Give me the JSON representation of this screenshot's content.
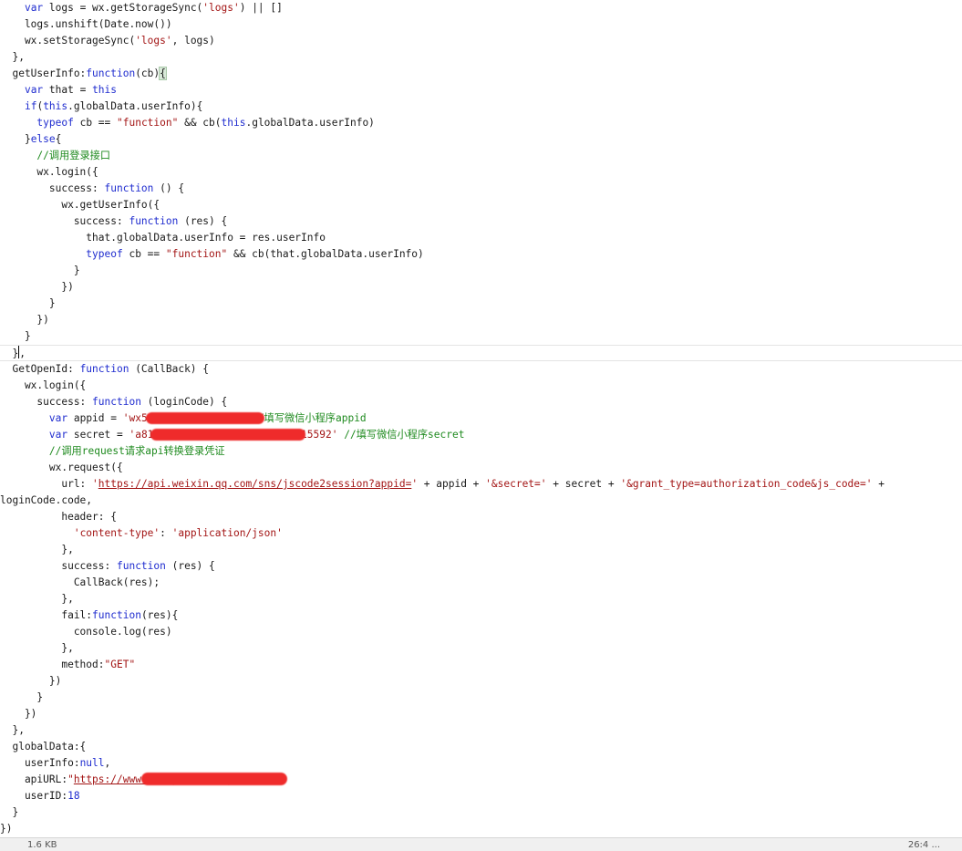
{
  "editor": {
    "lines": [
      [
        {
          "t": "    "
        },
        {
          "k": "kw",
          "t": "var"
        },
        {
          "t": " logs = wx.getStorageSync("
        },
        {
          "k": "str",
          "t": "'logs'"
        },
        {
          "t": ") || []"
        }
      ],
      [
        {
          "t": "    logs.unshift(Date.now())"
        }
      ],
      [
        {
          "t": "    wx.setStorageSync("
        },
        {
          "k": "str",
          "t": "'logs'"
        },
        {
          "t": ", logs)"
        }
      ],
      [
        {
          "t": "  },"
        }
      ],
      [
        {
          "t": "  getUserInfo:"
        },
        {
          "k": "kw",
          "t": "function"
        },
        {
          "t": "(cb)"
        },
        {
          "k": "bm",
          "t": "{"
        }
      ],
      [
        {
          "t": "    "
        },
        {
          "k": "kw",
          "t": "var"
        },
        {
          "t": " that = "
        },
        {
          "k": "kw",
          "t": "this"
        }
      ],
      [
        {
          "t": "    "
        },
        {
          "k": "kw",
          "t": "if"
        },
        {
          "t": "("
        },
        {
          "k": "kw",
          "t": "this"
        },
        {
          "t": ".globalData.userInfo){"
        }
      ],
      [
        {
          "t": "      "
        },
        {
          "k": "kw",
          "t": "typeof"
        },
        {
          "t": " cb == "
        },
        {
          "k": "str",
          "t": "\"function\""
        },
        {
          "t": " && cb("
        },
        {
          "k": "kw",
          "t": "this"
        },
        {
          "t": ".globalData.userInfo)"
        }
      ],
      [
        {
          "t": "    }"
        },
        {
          "k": "kw",
          "t": "else"
        },
        {
          "t": "{"
        }
      ],
      [
        {
          "t": "      "
        },
        {
          "k": "cm",
          "t": "//调用登录接口"
        }
      ],
      [
        {
          "t": "      wx.login({"
        }
      ],
      [
        {
          "t": "        success: "
        },
        {
          "k": "kw",
          "t": "function"
        },
        {
          "t": " () {"
        }
      ],
      [
        {
          "t": "          wx.getUserInfo({"
        }
      ],
      [
        {
          "t": "            success: "
        },
        {
          "k": "kw",
          "t": "function"
        },
        {
          "t": " (res) {"
        }
      ],
      [
        {
          "t": "              that.globalData.userInfo = res.userInfo"
        }
      ],
      [
        {
          "t": "              "
        },
        {
          "k": "kw",
          "t": "typeof"
        },
        {
          "t": " cb == "
        },
        {
          "k": "str",
          "t": "\"function\""
        },
        {
          "t": " && cb(that.globalData.userInfo)"
        }
      ],
      [
        {
          "t": "            }"
        }
      ],
      [
        {
          "t": "          })"
        }
      ],
      [
        {
          "t": "        }"
        }
      ],
      [
        {
          "t": "      })"
        }
      ],
      [
        {
          "t": "    }"
        }
      ],
      [
        {
          "t": "  }"
        },
        {
          "k": "cursor",
          "t": ""
        },
        {
          "t": ","
        }
      ],
      [
        {
          "t": "  GetOpenId: "
        },
        {
          "k": "kw",
          "t": "function"
        },
        {
          "t": " (CallBack) {"
        }
      ],
      [
        {
          "t": "    wx.login({"
        }
      ],
      [
        {
          "t": "      success: "
        },
        {
          "k": "kw",
          "t": "function"
        },
        {
          "t": " (loginCode) {"
        }
      ],
      [
        {
          "t": "        "
        },
        {
          "k": "kw",
          "t": "var"
        },
        {
          "t": " appid = "
        },
        {
          "k": "str",
          "t": "'wx5c4d8f2b1e3a7609'"
        },
        {
          "t": " "
        },
        {
          "k": "cm",
          "t": "//填写微信小程序appid"
        }
      ],
      [
        {
          "t": "        "
        },
        {
          "k": "kw",
          "t": "var"
        },
        {
          "t": " secret = "
        },
        {
          "k": "str",
          "t": "'a81d0f4c2b6e77d3a0c9bd5f19e15592'"
        },
        {
          "t": " "
        },
        {
          "k": "cm",
          "t": "//填写微信小程序secret"
        }
      ],
      [
        {
          "t": "        "
        },
        {
          "k": "cm",
          "t": "//调用request请求api转换登录凭证"
        }
      ],
      [
        {
          "t": "        wx.request({"
        }
      ],
      [
        {
          "t": "          url: "
        },
        {
          "k": "str",
          "t": "'"
        },
        {
          "k": "url",
          "t": "https://api.weixin.qq.com/sns/jscode2session?appid="
        },
        {
          "k": "str",
          "t": "'"
        },
        {
          "t": " + appid + "
        },
        {
          "k": "str",
          "t": "'&secret='"
        },
        {
          "t": " + secret + "
        },
        {
          "k": "str",
          "t": "'&grant_type=authorization_code&js_code='"
        },
        {
          "t": " +"
        }
      ],
      [
        {
          "t": "loginCode.code,"
        }
      ],
      [
        {
          "t": "          header: {"
        }
      ],
      [
        {
          "t": "            "
        },
        {
          "k": "str",
          "t": "'content-type'"
        },
        {
          "t": ": "
        },
        {
          "k": "str",
          "t": "'application/json'"
        }
      ],
      [
        {
          "t": "          },"
        }
      ],
      [
        {
          "t": "          success: "
        },
        {
          "k": "kw",
          "t": "function"
        },
        {
          "t": " (res) {"
        }
      ],
      [
        {
          "t": "            CallBack(res);"
        }
      ],
      [
        {
          "t": "          },"
        }
      ],
      [
        {
          "t": "          fail:"
        },
        {
          "k": "kw",
          "t": "function"
        },
        {
          "t": "(res){"
        }
      ],
      [
        {
          "t": "            console.log(res)"
        }
      ],
      [
        {
          "t": "          },"
        }
      ],
      [
        {
          "t": "          method:"
        },
        {
          "k": "str",
          "t": "\"GET\""
        }
      ],
      [
        {
          "t": "        })"
        }
      ],
      [
        {
          "t": "      }"
        }
      ],
      [
        {
          "t": "    })"
        }
      ],
      [
        {
          "t": "  },"
        }
      ],
      [
        {
          "t": "  globalData:{"
        }
      ],
      [
        {
          "t": "    userInfo:"
        },
        {
          "k": "kw",
          "t": "null"
        },
        {
          "t": ","
        }
      ],
      [
        {
          "t": "    apiURL:"
        },
        {
          "k": "str",
          "t": "\""
        },
        {
          "k": "url",
          "t": "https://www.example.com/api/"
        },
        {
          "k": "str",
          "t": "\""
        },
        {
          "t": ","
        }
      ],
      [
        {
          "t": "    userID:"
        },
        {
          "k": "kw",
          "t": "18"
        }
      ],
      [
        {
          "t": "  }"
        }
      ],
      [
        {
          "t": "})"
        }
      ]
    ]
  },
  "status": {
    "left": "1.6 KB",
    "right": "26:4    ..."
  },
  "colors": {
    "keyword": "#1f2ccf",
    "string": "#a31515",
    "comment": "#1e8a1e",
    "redaction": "#ef2b2b"
  }
}
